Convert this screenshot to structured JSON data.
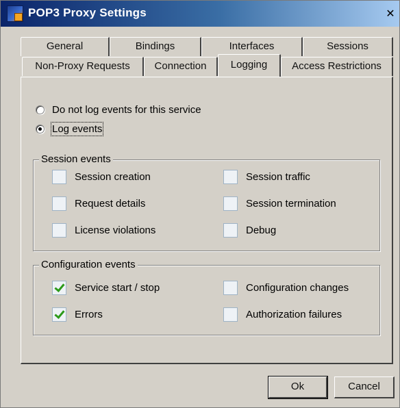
{
  "window": {
    "title": "POP3 Proxy Settings",
    "close_glyph": "✕"
  },
  "tabs": {
    "back_row": [
      "General",
      "Bindings",
      "Interfaces",
      "Sessions"
    ],
    "front_row": [
      "Non-Proxy Requests",
      "Connection",
      "Logging",
      "Access Restrictions"
    ],
    "active": "Logging"
  },
  "logging": {
    "radio_do_not_log": "Do not log events for this service",
    "radio_log_events": "Log events",
    "selected": "Log events"
  },
  "session_events": {
    "label": "Session events",
    "items": [
      {
        "label": "Session creation",
        "checked": false
      },
      {
        "label": "Request details",
        "checked": false
      },
      {
        "label": "License violations",
        "checked": false
      },
      {
        "label": "Session traffic",
        "checked": false
      },
      {
        "label": "Session termination",
        "checked": false
      },
      {
        "label": "Debug",
        "checked": false
      }
    ]
  },
  "configuration_events": {
    "label": "Configuration events",
    "items": [
      {
        "label": "Service start / stop",
        "checked": true
      },
      {
        "label": "Errors",
        "checked": true
      },
      {
        "label": "Configuration changes",
        "checked": false
      },
      {
        "label": "Authorization failures",
        "checked": false
      }
    ]
  },
  "buttons": {
    "ok": "Ok",
    "cancel": "Cancel"
  },
  "colors": {
    "titlebar_start": "#0a246a",
    "titlebar_end": "#a6caf0",
    "face": "#d4d0c8",
    "check_green": "#2c9a1a"
  },
  "icons": {
    "app": "app-icon",
    "close": "close-icon"
  }
}
